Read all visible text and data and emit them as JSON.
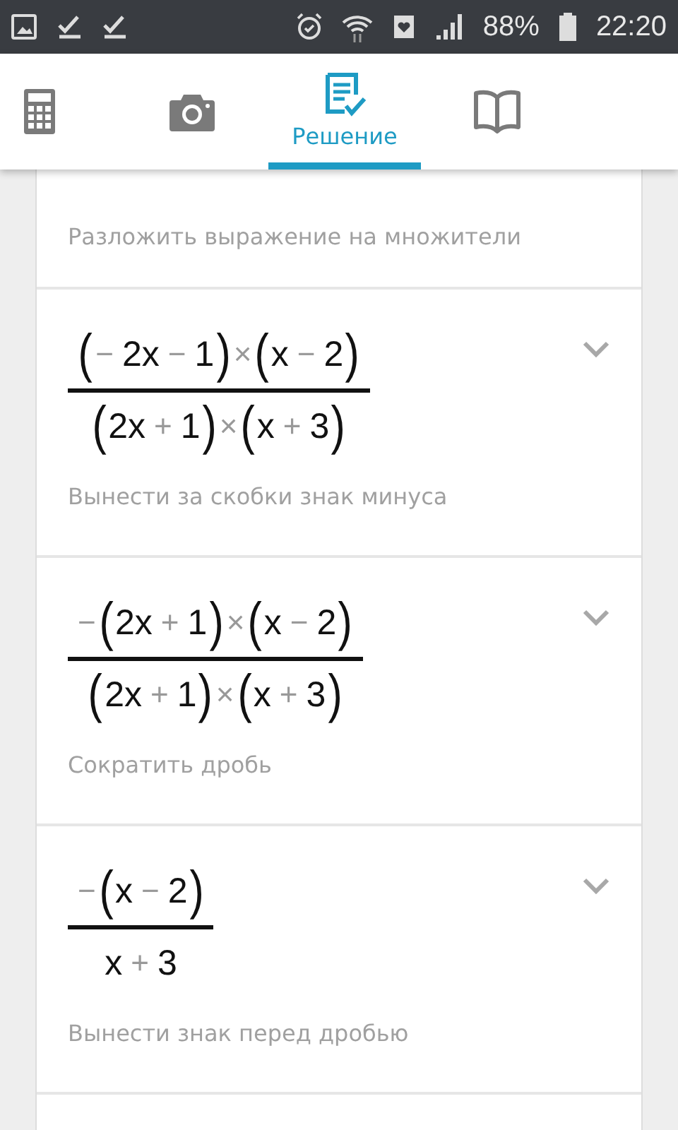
{
  "status_bar": {
    "battery": "88%",
    "time": "22:20"
  },
  "tabs": [
    {
      "kind": "calculator",
      "selected": false
    },
    {
      "kind": "camera",
      "selected": false
    },
    {
      "kind": "solution",
      "label": "Решение",
      "selected": true
    },
    {
      "kind": "book",
      "selected": false
    }
  ],
  "steps": [
    {
      "kind": "partial",
      "description": "Разложить выражение на множители"
    },
    {
      "kind": "fraction",
      "numerator": "(− 2x − 1)×(x − 2)",
      "denominator": "(2x + 1)×(x + 3)",
      "description": "Вынести за скобки знак минуса"
    },
    {
      "kind": "fraction",
      "numerator": "−(2x + 1)×(x − 2)",
      "denominator": "(2x + 1)×(x + 3)",
      "description": "Сократить дробь"
    },
    {
      "kind": "fraction",
      "numerator": "−(x − 2)",
      "denominator": "x + 3",
      "description": "Вынести знак перед дробью"
    }
  ]
}
